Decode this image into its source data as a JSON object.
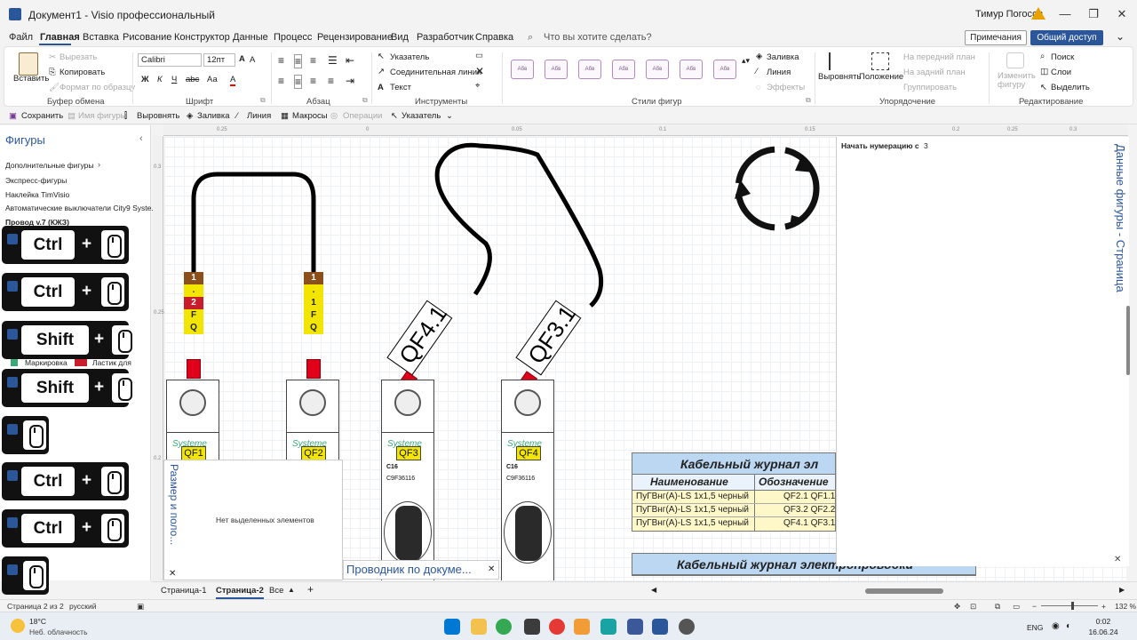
{
  "window": {
    "title": "Документ1  -  Visio профессиональный",
    "user": "Тимур Погосов"
  },
  "menu": {
    "items": [
      "Файл",
      "Главная",
      "Вставка",
      "Рисование",
      "Конструктор",
      "Данные",
      "Процесс",
      "Рецензирование",
      "Вид",
      "Разработчик",
      "Справка"
    ],
    "tell_me": "Что вы хотите сделать?",
    "comments": "Примечания",
    "share": "Общий доступ"
  },
  "ribbon": {
    "clipboard": {
      "paste": "Вставить",
      "cut": "Вырезать",
      "copy": "Копировать",
      "format_painter": "Формат по образцу",
      "label": "Буфер обмена"
    },
    "font": {
      "name": "Calibri",
      "size": "12пт",
      "bold": "Ж",
      "italic": "К",
      "underline": "Ч",
      "strike": "abc",
      "case": "Аа",
      "color": "А",
      "label": "Шрифт"
    },
    "paragraph": {
      "label": "Абзац"
    },
    "tools": {
      "pointer": "Указатель",
      "connector": "Соединительная линия",
      "text": "Текст",
      "label": "Инструменты"
    },
    "shape_styles": {
      "thumbs": [
        "Абв",
        "Абв",
        "Абв",
        "Абв",
        "Абв",
        "Абв",
        "Абв"
      ],
      "fill": "Заливка",
      "line": "Линия",
      "effects": "Эффекты",
      "label": "Стили фигур"
    },
    "arrange": {
      "align": "Выровнять",
      "position": "Положение",
      "front": "На передний план",
      "back": "На задний план",
      "group": "Группировать",
      "label": "Упорядочение"
    },
    "editing": {
      "change_shape": "Изменить фигуру",
      "find": "Поиск",
      "layers": "Слои",
      "select": "Выделить",
      "label": "Редактирование"
    }
  },
  "qat": {
    "save": "Сохранить",
    "shape_name": "Имя фигуры",
    "align": "Выровнять",
    "fill": "Заливка",
    "line": "Линия",
    "macros": "Макросы",
    "operations": "Операции",
    "pointer": "Указатель"
  },
  "shapes_pane": {
    "title": "Фигуры",
    "more": "Дополнительные фигуры",
    "quick": "Экспресс-фигуры",
    "sticker": "Наклейка TimVisio",
    "breakers": "Автоматические выключатели City9 Syste...",
    "wire": "Провод v.7 (КЖЗ)",
    "marking": "Маркировка",
    "eraser": "Ластик для"
  },
  "key_overlays": [
    {
      "key": "Ctrl",
      "plus": "+"
    },
    {
      "key": "Ctrl",
      "plus": "+"
    },
    {
      "key": "Shift",
      "plus": "+"
    },
    {
      "key": "Shift",
      "plus": "+"
    },
    {
      "key": "",
      "plus": ""
    },
    {
      "key": "Ctrl",
      "plus": "+"
    },
    {
      "key": "Ctrl",
      "plus": "+"
    },
    {
      "key": "",
      "plus": ""
    }
  ],
  "ruler_h": [
    "0.25",
    "0",
    "0.05",
    "0.1",
    "0.15",
    "0.2",
    "0.25",
    "0.3"
  ],
  "ruler_v": [
    "0.3",
    "0.25",
    "0.2"
  ],
  "canvas": {
    "breakers": [
      {
        "brand": "Systeme",
        "tag": "QF1",
        "line1": "",
        "line2": ""
      },
      {
        "brand": "Systeme",
        "tag": "QF2",
        "line1": "",
        "line2": ""
      },
      {
        "brand": "Systeme",
        "tag": "QF3",
        "line1": "C16",
        "line2": "C9F36116"
      },
      {
        "brand": "Systeme",
        "tag": "QF4",
        "line1": "C16",
        "line2": "C9F36116"
      }
    ],
    "marker1": [
      "1",
      ".",
      "2",
      "F",
      "Q"
    ],
    "marker2": [
      "1",
      ".",
      "1",
      "F",
      "Q"
    ],
    "label_qf41": "QF4.1",
    "label_qf31": "QF3.1",
    "table1": {
      "title": "Кабельный журнал эл",
      "col1": "Наименование",
      "col2": "Обозначение",
      "rows": [
        {
          "name": "ПуГВнг(А)-LS 1х1,5 черный",
          "code": "QF2.1 QF1.1"
        },
        {
          "name": "ПуГВнг(А)-LS 1х1,5 черный",
          "code": "QF3.2 QF2.2"
        },
        {
          "name": "ПуГВнг(А)-LS 1х1,5 черный",
          "code": "QF4.1 QF3.1"
        }
      ]
    },
    "table2": {
      "title": "Кабельный журнал электропроводки"
    }
  },
  "data_pane": {
    "title": "Данные фигуры - Страница",
    "field_label": "Начать нумерацию с",
    "field_value": "3"
  },
  "size_pos": {
    "title": "Размер и поло...",
    "message": "Нет выделенных элементов"
  },
  "navigator": {
    "title": "Проводник по докуме..."
  },
  "page_tabs": {
    "tab1": "Страница-1",
    "tab2": "Страница-2",
    "all": "Все"
  },
  "status": {
    "page": "Страница 2 из 2",
    "lang": "русский",
    "zoom": "132 %"
  },
  "taskbar": {
    "temp": "18°C",
    "weather": "Неб. облачность",
    "lang": "ENG",
    "time": "0:02",
    "date": "16.06.24"
  },
  "colors": {
    "accent": "#2b579a",
    "wire": "#000000",
    "tip": "#e0001a",
    "tag": "#f2e600",
    "table_head": "#bcd7f2",
    "table_row": "#fef7c8"
  }
}
